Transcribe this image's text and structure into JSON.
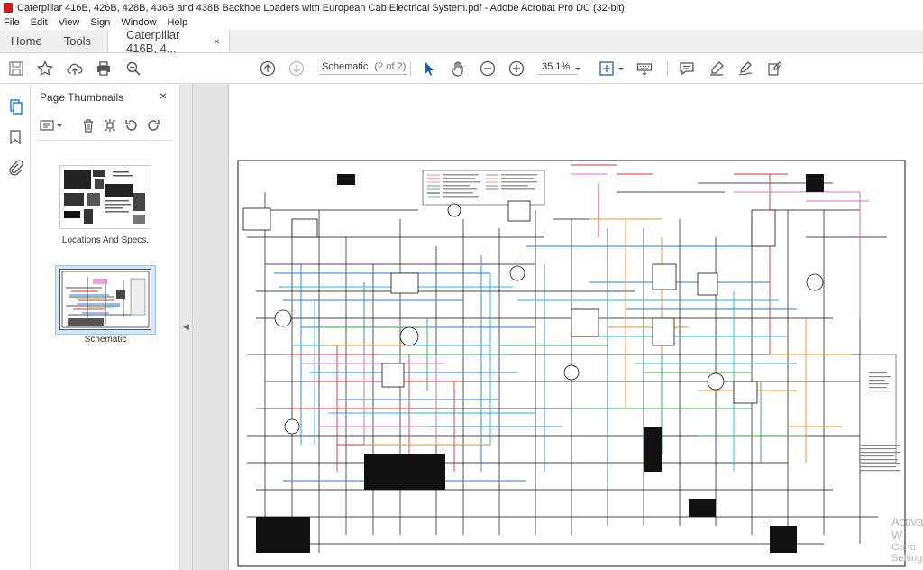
{
  "window": {
    "title": "Caterpillar 416B, 426B, 428B, 436B and 438B Backhoe Loaders with European Cab Electrical System.pdf - Adobe Acrobat Pro DC (32-bit)"
  },
  "menu": [
    "File",
    "Edit",
    "View",
    "Sign",
    "Window",
    "Help"
  ],
  "tabs": {
    "home": "Home",
    "tools": "Tools",
    "document": "Caterpillar 416B, 4...",
    "document_close": "×"
  },
  "toolbar": {
    "page_label": "Schematic",
    "page_count": "(2 of 2)",
    "zoom": "35.1%"
  },
  "panel": {
    "title": "Page Thumbnails",
    "close": "×",
    "thumbnails": [
      {
        "label": "Locations And Specs."
      },
      {
        "label": "Schematic"
      }
    ]
  },
  "watermark": {
    "line1": "Activate W",
    "line2": "Go to Settings"
  },
  "colors": {
    "accent": "#1473e6",
    "wire_red": "#e0303a",
    "wire_blue": "#2a7fd0",
    "wire_cyan": "#20b6d6",
    "wire_green": "#2ea84a",
    "wire_orange": "#e8922a",
    "wire_pink": "#e070b8",
    "wire_black": "#111111"
  }
}
